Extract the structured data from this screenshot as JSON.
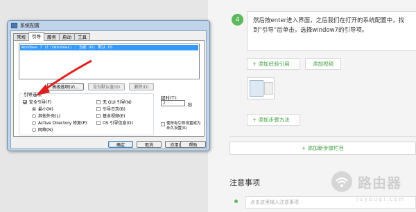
{
  "dialog": {
    "title": "系统配置",
    "tabs": [
      {
        "label": "常规"
      },
      {
        "label": "引导"
      },
      {
        "label": "服务"
      },
      {
        "label": "启动"
      },
      {
        "label": "工具"
      }
    ],
    "os_entry": "Windows 7 (C:\\Windows) : 当前 OS; 默认 OS",
    "advanced_button": "高级选项(V)...",
    "set_default_button": "设为默认值(D)",
    "delete_button": "删除(D)",
    "boot_options_label": "引导选项",
    "safe_boot": {
      "label": "安全引导(F)",
      "checked": true
    },
    "radios": [
      {
        "label": "最小(M)",
        "selected": true
      },
      {
        "label": "其他外壳(L)",
        "selected": false
      },
      {
        "label": "Active Directory 修复(P)",
        "selected": false
      },
      {
        "label": "网络(N)",
        "selected": false
      }
    ],
    "right_options": [
      {
        "label": "无 GUI 引导(N)",
        "checked": false
      },
      {
        "label": "引导日志(B)",
        "checked": false
      },
      {
        "label": "基本视频(E)",
        "checked": false
      },
      {
        "label": "OS 引导信息(O)",
        "checked": false
      }
    ],
    "timeout_label": "超时(T):",
    "timeout_value": "2",
    "timeout_unit": "秒",
    "permanent_label": "使所有引导设置成为永久设置(K)",
    "buttons": {
      "ok": "确定",
      "cancel": "取消",
      "apply": "应用(A)",
      "help": "帮助"
    }
  },
  "step": {
    "number": "4",
    "text": "然后按enter进入界面，之后我们在打开的系统配置中，找到“引导”后单击，选择window7的引导项。"
  },
  "actions": {
    "add_experience": "+ 添加经验引用",
    "add_video": "添加视频",
    "add_method": "+ 添加步骤方法",
    "add_section": "+ 添加新步骤栏目"
  },
  "notes": {
    "title": "注意事项",
    "placeholder": "点击这里输入注意事项"
  },
  "watermark": {
    "brand": "路由器",
    "url": "luyouqi.com"
  },
  "colors": {
    "accent_green": "#5cb85c",
    "link_green": "#3f9d3f",
    "arrow_red": "#e02020"
  }
}
